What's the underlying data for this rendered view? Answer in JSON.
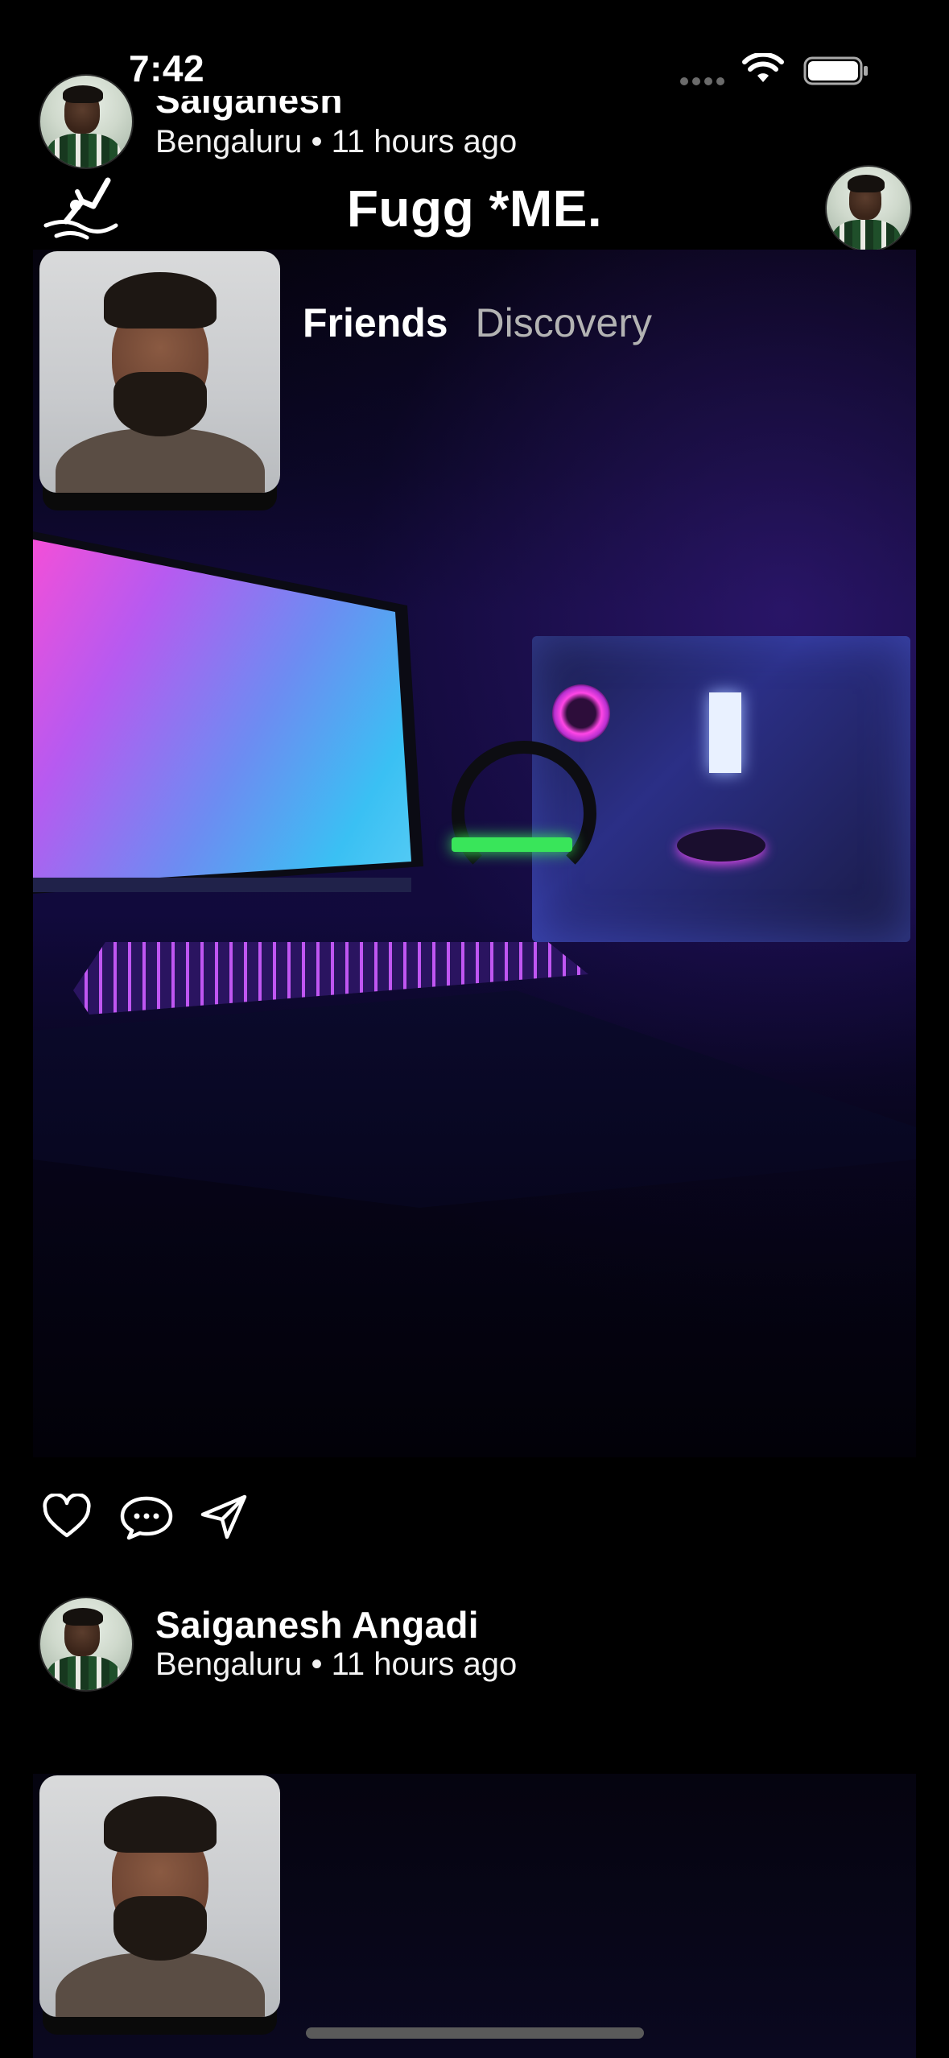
{
  "status_bar": {
    "time": "7:42"
  },
  "app_bar": {
    "title": "Fugg *ME."
  },
  "tabs": {
    "friends": "Friends",
    "discovery": "Discovery"
  },
  "posts": [
    {
      "author": "Saiganesh Angadi",
      "author_visible": "Saiganesh",
      "location": "Bengaluru",
      "separator": "•",
      "time_ago": "11 hours ago"
    },
    {
      "author": "Saiganesh Angadi",
      "location": "Bengaluru",
      "separator": "•",
      "time_ago": "11 hours ago"
    }
  ],
  "icons": {
    "logo": "diving-person-icon",
    "like": "heart-icon",
    "comment": "chat-bubble-icon",
    "share": "send-arrow-icon",
    "wifi": "wifi-icon",
    "battery": "battery-icon"
  },
  "colors": {
    "background": "#000000",
    "text": "#ffffff",
    "inactive_tab": "#b3b3b3"
  }
}
